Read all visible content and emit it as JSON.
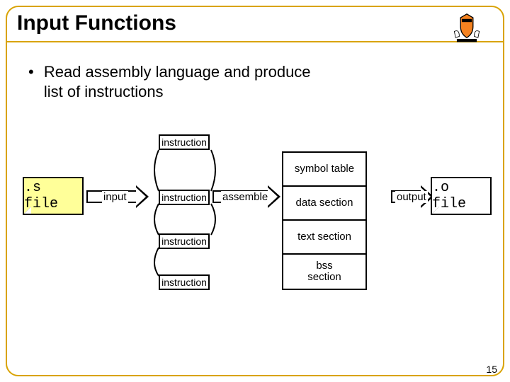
{
  "title": "Input Functions",
  "bullet": {
    "line1": "Read assembly language and produce",
    "line2": "list of instructions"
  },
  "labels": {
    "sfile": ".s file",
    "ofile": ".o file",
    "input": "input",
    "assemble": "assemble",
    "output": "output",
    "instruction": "instruction"
  },
  "sections": {
    "symbol_table": "symbol table",
    "data_section": "data section",
    "text_section": "text section",
    "bss_section": "bss section"
  },
  "pagenum": "15"
}
